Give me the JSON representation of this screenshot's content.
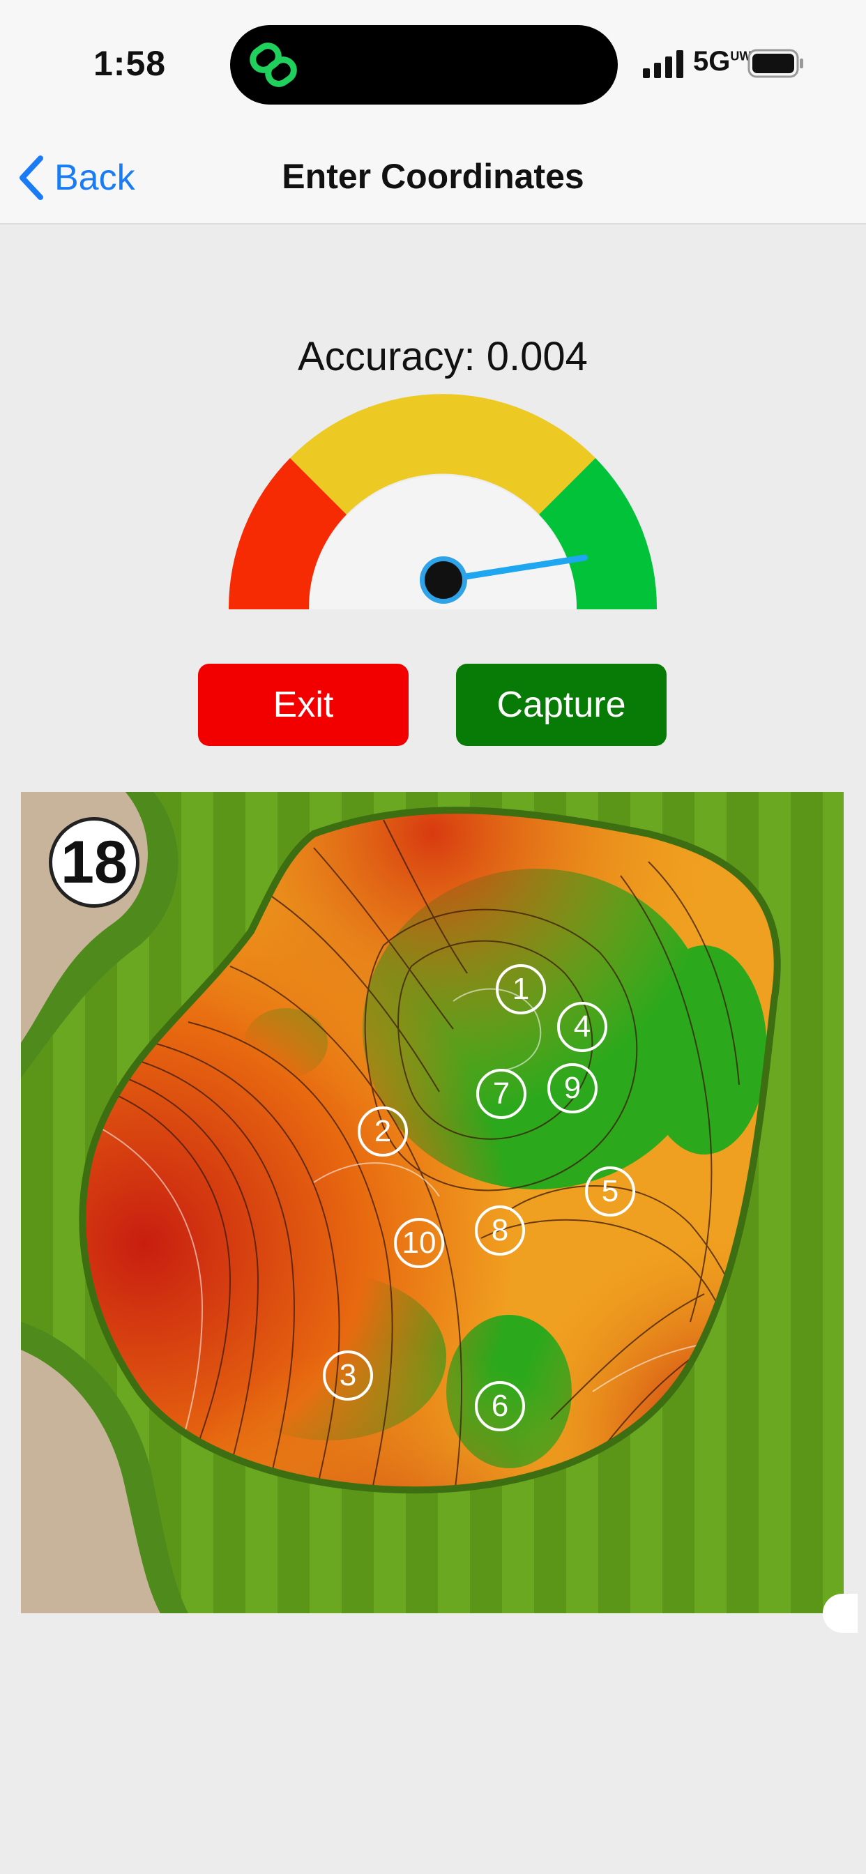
{
  "status": {
    "time": "1:58",
    "network": "5G",
    "network_sup": "UW"
  },
  "nav": {
    "back_label": "Back",
    "title": "Enter Coordinates"
  },
  "gauge": {
    "accuracy_text": "Accuracy: 0.004",
    "needle_level": 0.95,
    "zones": [
      {
        "name": "poor",
        "color": "#f62a03"
      },
      {
        "name": "fair",
        "color": "#ecc923"
      },
      {
        "name": "good",
        "color": "#02c23a"
      }
    ],
    "needle_color": "#1fa6f0"
  },
  "buttons": {
    "exit_label": "Exit",
    "capture_label": "Capture"
  },
  "map": {
    "hole_number": "18",
    "pins": [
      {
        "label": "1"
      },
      {
        "label": "4"
      },
      {
        "label": "7"
      },
      {
        "label": "9"
      },
      {
        "label": "2"
      },
      {
        "label": "5"
      },
      {
        "label": "8"
      },
      {
        "label": "10"
      },
      {
        "label": "3"
      },
      {
        "label": "6"
      }
    ]
  }
}
